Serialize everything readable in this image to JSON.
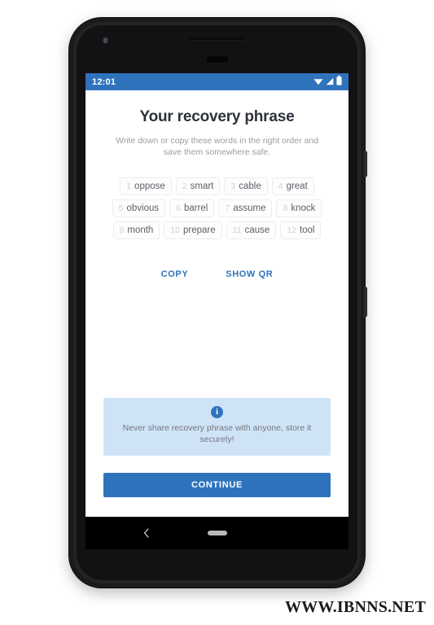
{
  "status_bar": {
    "time": "12:01",
    "icons": [
      "wifi-icon",
      "signal-icon",
      "battery-icon"
    ]
  },
  "screen": {
    "title": "Your recovery phrase",
    "subtitle": "Write down or copy these words in the right order and save them somewhere safe.",
    "recovery_words": [
      {
        "index": "1",
        "word": "oppose"
      },
      {
        "index": "2",
        "word": "smart"
      },
      {
        "index": "3",
        "word": "cable"
      },
      {
        "index": "4",
        "word": "great"
      },
      {
        "index": "5",
        "word": "obvious"
      },
      {
        "index": "6",
        "word": "barrel"
      },
      {
        "index": "7",
        "word": "assume"
      },
      {
        "index": "8",
        "word": "knock"
      },
      {
        "index": "9",
        "word": "month"
      },
      {
        "index": "10",
        "word": "prepare"
      },
      {
        "index": "11",
        "word": "cause"
      },
      {
        "index": "12",
        "word": "tool"
      }
    ],
    "actions": {
      "copy_label": "COPY",
      "show_qr_label": "SHOW QR"
    },
    "info_banner": {
      "icon": "info-icon",
      "text": "Never share recovery phrase with anyone, store it securely!"
    },
    "continue_label": "CONTINUE"
  },
  "nav_bar": {
    "back_label": "back-icon",
    "home_label": "home-pill"
  },
  "watermark": {
    "text": "WWW.IBNNS.NET"
  },
  "colors": {
    "accent": "#2f73bd",
    "info_bg": "#cfe3f7",
    "title": "#2e323c",
    "muted": "#9a9da3"
  }
}
